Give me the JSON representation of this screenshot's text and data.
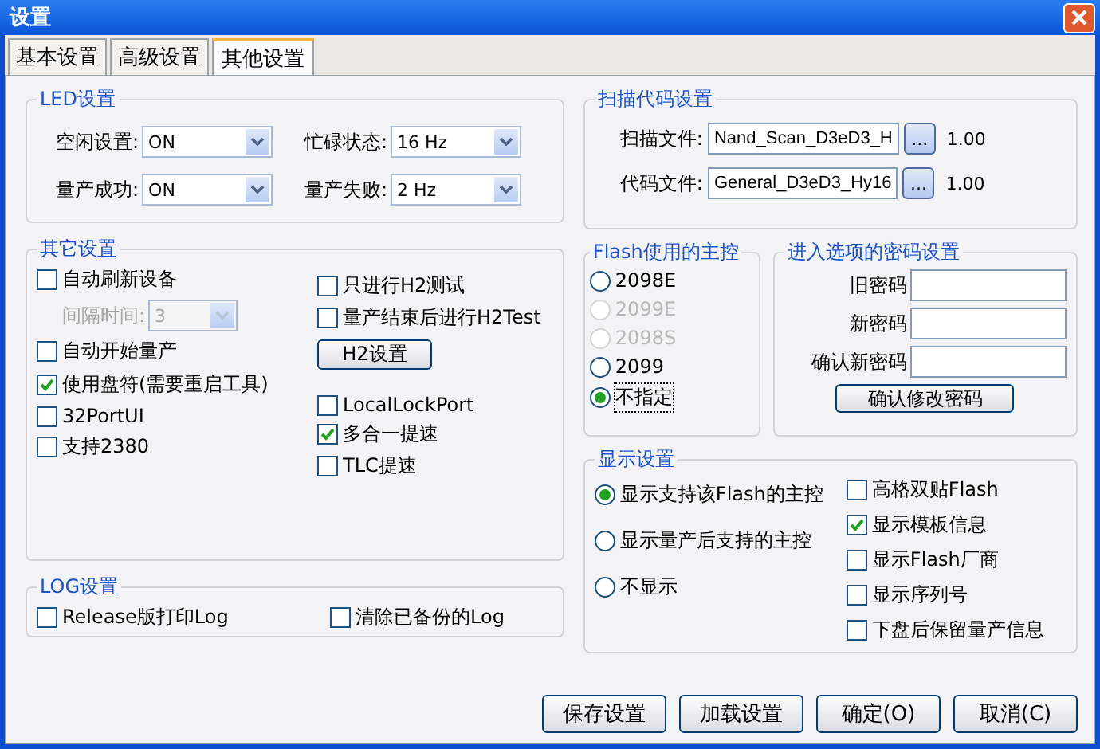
{
  "window": {
    "title": "设置"
  },
  "tabs": [
    {
      "label": "基本设置",
      "selected": false
    },
    {
      "label": "高级设置",
      "selected": false
    },
    {
      "label": "其他设置",
      "selected": true
    }
  ],
  "led_settings": {
    "title": "LED设置",
    "fields": [
      {
        "label": "空闲设置:",
        "value": "ON"
      },
      {
        "label": "忙碌状态:",
        "value": "16 Hz"
      },
      {
        "label": "量产成功:",
        "value": "ON"
      },
      {
        "label": "量产失败:",
        "value": "2 Hz"
      }
    ]
  },
  "other_settings": {
    "title": "其它设置",
    "left": [
      {
        "kind": "checkbox",
        "label": "自动刷新设备",
        "checked": false
      },
      {
        "kind": "dropdown",
        "label": "间隔时间:",
        "value": "3",
        "disabled": true
      },
      {
        "kind": "checkbox",
        "label": "自动开始量产",
        "checked": false
      },
      {
        "kind": "checkbox",
        "label": "使用盘符(需要重启工具)",
        "checked": true
      },
      {
        "kind": "checkbox",
        "label": "32PortUI",
        "checked": false
      },
      {
        "kind": "checkbox",
        "label": "支持2380",
        "checked": false
      }
    ],
    "right": [
      {
        "kind": "checkbox",
        "label": "只进行H2测试",
        "checked": false
      },
      {
        "kind": "checkbox",
        "label": "量产结束后进行H2Test",
        "checked": false
      },
      {
        "kind": "button",
        "label": "H2设置"
      },
      {
        "kind": "checkbox",
        "label": "LocalLockPort",
        "checked": false
      },
      {
        "kind": "checkbox",
        "label": "多合一提速",
        "checked": true
      },
      {
        "kind": "checkbox",
        "label": "TLC提速",
        "checked": false
      }
    ]
  },
  "log_settings": {
    "title": "LOG设置",
    "checkboxes": [
      {
        "label": "Release版打印Log",
        "checked": false
      },
      {
        "label": "清除已备份的Log",
        "checked": false
      }
    ]
  },
  "scan_code_settings": {
    "title": "扫描代码设置",
    "files": [
      {
        "label": "扫描文件:",
        "value": "Nand_Scan_D3eD3_H",
        "browse": "...",
        "version": "1.00"
      },
      {
        "label": "代码文件:",
        "value": "General_D3eD3_Hy16",
        "browse": "...",
        "version": "1.00"
      }
    ]
  },
  "flash_controller": {
    "title": "Flash使用的主控",
    "options": [
      {
        "label": "2098E",
        "selected": false,
        "disabled": false
      },
      {
        "label": "2099E",
        "selected": false,
        "disabled": true
      },
      {
        "label": "2098S",
        "selected": false,
        "disabled": true
      },
      {
        "label": "2099",
        "selected": false,
        "disabled": false
      },
      {
        "label": "不指定",
        "selected": true,
        "disabled": false
      }
    ]
  },
  "password_settings": {
    "title": "进入选项的密码设置",
    "fields": [
      {
        "label": "旧密码"
      },
      {
        "label": "新密码"
      },
      {
        "label": "确认新密码"
      }
    ],
    "button": "确认修改密码"
  },
  "display_settings": {
    "title": "显示设置",
    "options": [
      {
        "label": "显示支持该Flash的主控",
        "selected": true
      },
      {
        "label": "显示量产后支持的主控",
        "selected": false
      },
      {
        "label": "不显示",
        "selected": false
      }
    ],
    "checkboxes": [
      {
        "label": "高格双贴Flash",
        "checked": false
      },
      {
        "label": "显示模板信息",
        "checked": true
      },
      {
        "label": "显示Flash厂商",
        "checked": false
      },
      {
        "label": "显示序列号",
        "checked": false
      },
      {
        "label": "下盘后保留量产信息",
        "checked": false
      }
    ]
  },
  "buttons": [
    "保存设置",
    "加载设置",
    "确定(O)",
    "取消(C)"
  ]
}
